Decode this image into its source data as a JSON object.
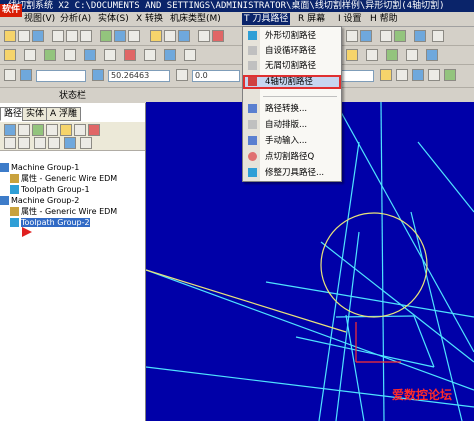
{
  "titlebar": {
    "badge": "软件",
    "text": "线切割系统  X2  C:\\DOCUMENTS AND SETTINGS\\ADMINISTRATOR\\桌面\\线切割样例\\异形切割(4轴切割)"
  },
  "menubar": {
    "items": [
      "视图(V)",
      "分析(A)",
      "实体(S)",
      "X 转换",
      "机床类型(M)",
      "T 刀具路径",
      "R 屏幕",
      "I 设置",
      "H 帮助"
    ]
  },
  "toolbar_fields": {
    "value1": "50.26463",
    "value2": "0.0"
  },
  "status_label": "状态栏",
  "left_panel": {
    "tabs": [
      "路径",
      "实体",
      "A 浮雕"
    ],
    "tree": [
      "Machine Group-1",
      "属性 - Generic Wire EDM",
      "Toolpath Group-1",
      "Machine Group-2",
      "属性 - Generic Wire EDM",
      "Toolpath Group-2"
    ]
  },
  "dropdown": {
    "items": [
      "外形切割路径",
      "自设循环路径",
      "无屑切割路径",
      "4轴切割路径",
      "路径转换...",
      "自动排版...",
      "手动输入...",
      "点切割路径Q",
      "修整刀具路径..."
    ],
    "highlighted": "4轴切割路径"
  },
  "watermark": "爱数控论坛",
  "colors": {
    "graphics_bg": "#0000a8",
    "geometry_cyan": "#4fe3ff",
    "geometry_yellow": "#e8e27a",
    "toolpath_red": "#ff3030",
    "menu_highlight": "#0a246a"
  }
}
